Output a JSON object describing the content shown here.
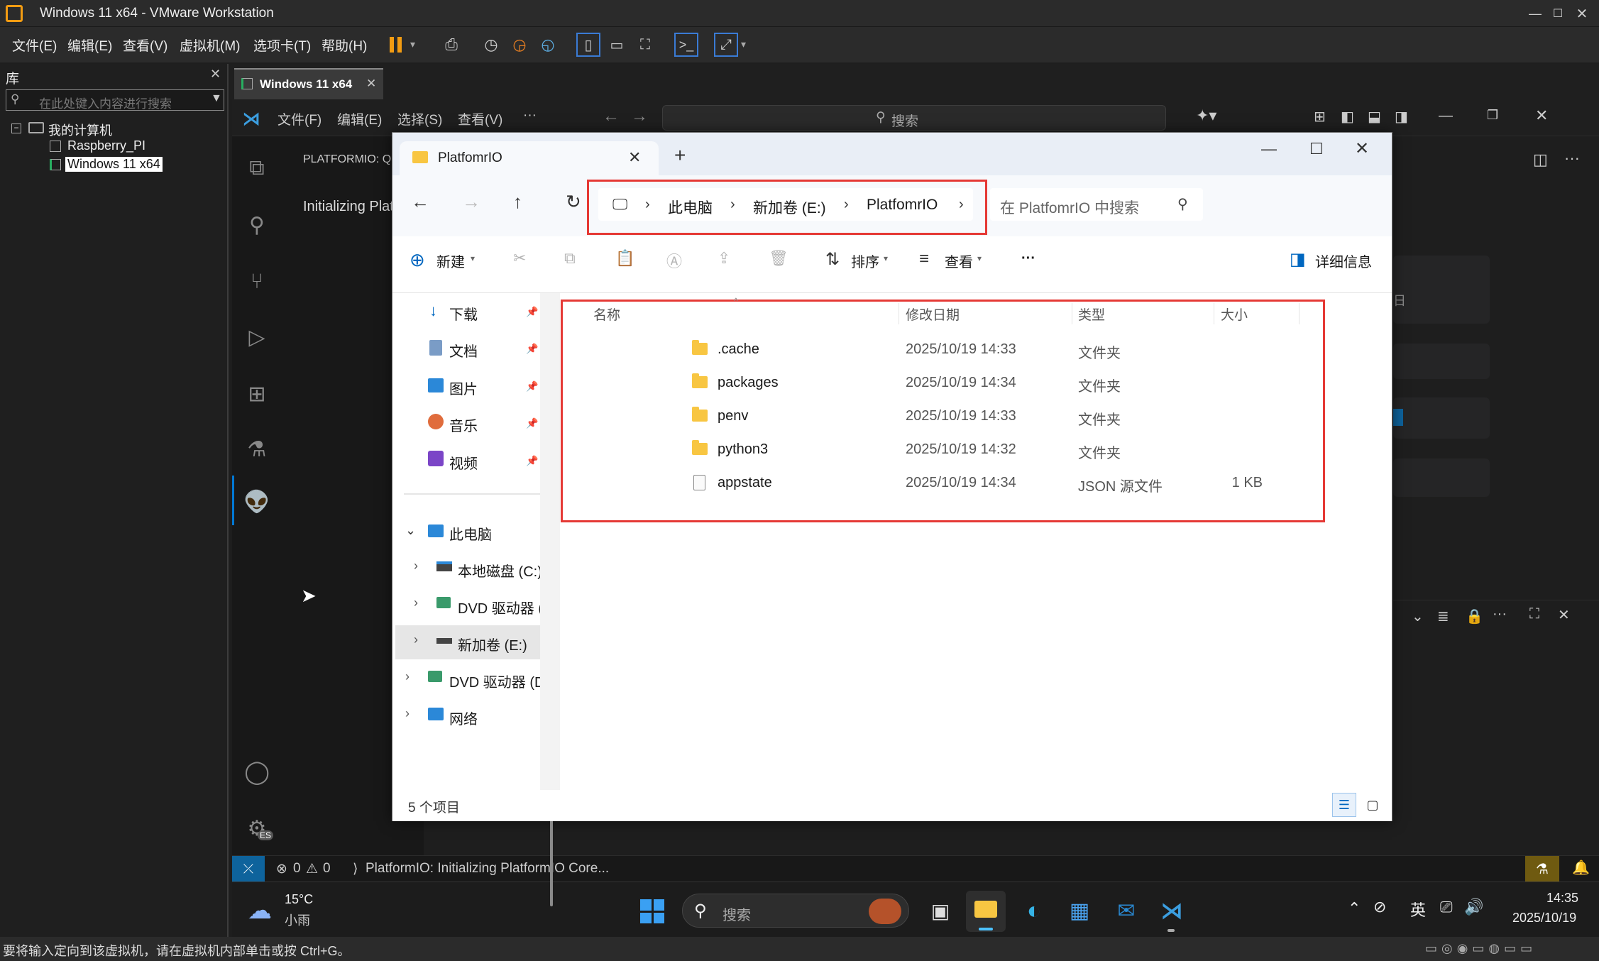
{
  "vmware": {
    "title": "Windows 11 x64 - VMware Workstation",
    "menu": [
      "文件(E)",
      "编辑(E)",
      "查看(V)",
      "虚拟机(M)",
      "选项卡(T)",
      "帮助(H)"
    ],
    "library_title": "库",
    "library_search_placeholder": "在此处键入内容进行搜索",
    "tree_root": "我的计算机",
    "tree_items": [
      "Raspberry_PI",
      "Windows 11 x64"
    ],
    "vm_tab": "Windows 11 x64",
    "status_hint": "要将输入定向到该虚拟机，请在虚拟机内部单击或按 Ctrl+G。"
  },
  "vscode": {
    "menu": [
      "文件(F)",
      "编辑(E)",
      "选择(S)",
      "查看(V)",
      "···"
    ],
    "search_label": "搜索",
    "panel_title": "PLATFORMIO: QU",
    "panel_text": "Initializing Platf",
    "partial_side_text": "日",
    "status": {
      "errors": "0",
      "warnings": "0",
      "message": "PlatformIO: Initializing PlatformIO Core..."
    },
    "account_badge": "ES"
  },
  "explorer": {
    "tab_title": "PlatfomrIO",
    "breadcrumb": [
      "此电脑",
      "新加卷 (E:)",
      "PlatfomrIO"
    ],
    "search_placeholder": "在 PlatfomrIO 中搜索",
    "cmd": {
      "new": "新建",
      "sort": "排序",
      "view": "查看",
      "more": "···",
      "details": "详细信息"
    },
    "quick_access": [
      {
        "label": "下载",
        "icon": "download-icon"
      },
      {
        "label": "文档",
        "icon": "document-icon"
      },
      {
        "label": "图片",
        "icon": "picture-icon"
      },
      {
        "label": "音乐",
        "icon": "music-icon"
      },
      {
        "label": "视频",
        "icon": "video-icon"
      }
    ],
    "tree": [
      {
        "label": "此电脑",
        "icon": "computer-icon"
      },
      {
        "label": "本地磁盘 (C:)",
        "icon": "drive-icon"
      },
      {
        "label": "DVD 驱动器 (I",
        "icon": "dvd-icon"
      },
      {
        "label": "新加卷 (E:)",
        "icon": "drive-icon"
      },
      {
        "label": "DVD 驱动器 (D:",
        "icon": "dvd-icon"
      },
      {
        "label": "网络",
        "icon": "network-icon"
      }
    ],
    "columns": [
      "名称",
      "修改日期",
      "类型",
      "大小"
    ],
    "files": [
      {
        "name": ".cache",
        "date": "2025/10/19 14:33",
        "type": "文件夹",
        "size": ""
      },
      {
        "name": "packages",
        "date": "2025/10/19 14:34",
        "type": "文件夹",
        "size": ""
      },
      {
        "name": "penv",
        "date": "2025/10/19 14:33",
        "type": "文件夹",
        "size": ""
      },
      {
        "name": "python3",
        "date": "2025/10/19 14:32",
        "type": "文件夹",
        "size": ""
      },
      {
        "name": "appstate",
        "date": "2025/10/19 14:34",
        "type": "JSON 源文件",
        "size": "1 KB"
      }
    ],
    "item_count": "5 个项目"
  },
  "taskbar": {
    "weather_temp": "15°C",
    "weather_desc": "小雨",
    "search_label": "搜索",
    "ime": "英",
    "time": "14:35",
    "date": "2025/10/19"
  },
  "colors": {
    "accent": "#0078d4",
    "highlight_box": "#e53935",
    "vscode_status_remote": "#0e639c"
  }
}
